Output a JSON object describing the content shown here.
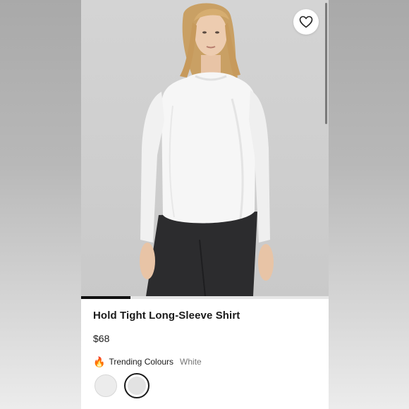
{
  "product": {
    "name": "Hold Tight Long-Sleeve Shirt",
    "price": "$68",
    "trending_label": "Trending Colours",
    "selected_colour": "White",
    "trending_icon": "fire-icon"
  },
  "gallery": {
    "progress_fraction": 0.2,
    "favorite_icon": "heart-icon"
  },
  "swatches": [
    {
      "name": "swatch-light-grey",
      "selected": false
    },
    {
      "name": "swatch-white",
      "selected": true
    }
  ],
  "colors": {
    "accent": "#111111",
    "muted_text": "#777777"
  }
}
